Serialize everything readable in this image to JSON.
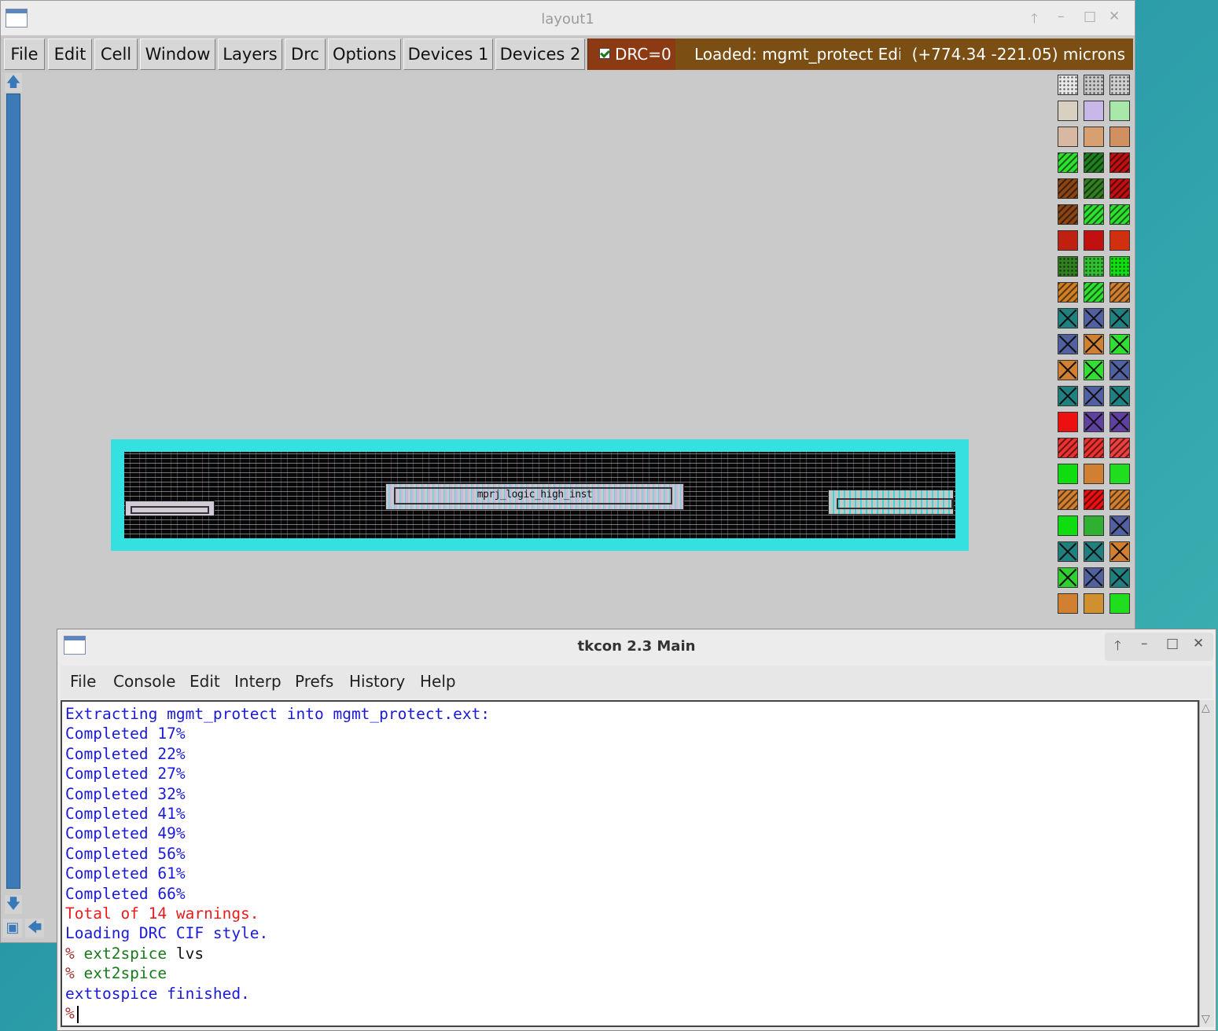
{
  "layout_window": {
    "title": "layout1",
    "controls": {
      "up": "🡑",
      "min": "–",
      "max": "□",
      "close": "✕"
    },
    "menu": [
      "File",
      "Edit",
      "Cell",
      "Window",
      "Layers",
      "Drc",
      "Options",
      "Devices 1",
      "Devices 2"
    ],
    "drc_label": "DRC=0",
    "drc_checked": true,
    "status_loaded": "Loaded: mgmt_protect Edit",
    "status_coords": "(+774.34 -221.05) microns",
    "design_label": "mprj_logic_high_inst",
    "colors": {
      "drc_bg": "#8b3a14",
      "status_bg": "#7b4e14",
      "design_outline": "#34e0e0",
      "scrollbar": "#3d7ab8"
    },
    "palette": [
      [
        "#e8e8e8",
        "#c8c8c8",
        "#d0d0d0"
      ],
      [
        "#d8d0c0",
        "#c8b8e8",
        "#a8e8a8"
      ],
      [
        "#d8b8a0",
        "#d8a070",
        "#d09060"
      ],
      [
        "#30e030",
        "#208020",
        "#c01010"
      ],
      [
        "#8b4513",
        "#308020",
        "#c01010"
      ],
      [
        "#8b4513",
        "#30e030",
        "#30e030"
      ],
      [
        "#c02010",
        "#c01010",
        "#d03010"
      ],
      [
        "#308020",
        "#30c030",
        "#10e010"
      ],
      [
        "#d08020",
        "#30e030",
        "#d08030"
      ],
      [
        "#208080",
        "#5060a0",
        "#208080"
      ],
      [
        "#5060a0",
        "#d08030",
        "#30e030"
      ],
      [
        "#d08030",
        "#30e030",
        "#5060a0"
      ],
      [
        "#208080",
        "#5060a0",
        "#208080"
      ],
      [
        "#ee1010",
        "#6040a0",
        "#6040a0"
      ],
      [
        "#ee3030",
        "#ee3030",
        "#ee4040"
      ],
      [
        "#10dd10",
        "#d08030",
        "#20dd20"
      ],
      [
        "#d08030",
        "#ee1010",
        "#d08030"
      ],
      [
        "#10dd10",
        "#30b030",
        "#5060a0"
      ],
      [
        "#208080",
        "#208080",
        "#d08030"
      ],
      [
        "#30d030",
        "#5060a0",
        "#208080"
      ],
      [
        "#d08030",
        "#d09030",
        "#20dd20"
      ]
    ]
  },
  "tkcon": {
    "title": "tkcon 2.3 Main",
    "controls": {
      "up": "🡑",
      "min": "–",
      "max": "□",
      "close": "✕"
    },
    "menu": [
      "File",
      "Console",
      "Edit",
      "Interp",
      "Prefs",
      "History",
      "Help"
    ],
    "lines": [
      {
        "prompt": "",
        "text": "Extracting mgmt_protect into mgmt_protect.ext:",
        "arg": "",
        "color": "blue"
      },
      {
        "prompt": "",
        "text": "Completed 17%",
        "arg": "",
        "color": "blue"
      },
      {
        "prompt": "",
        "text": "Completed 22%",
        "arg": "",
        "color": "blue"
      },
      {
        "prompt": "",
        "text": "Completed 27%",
        "arg": "",
        "color": "blue"
      },
      {
        "prompt": "",
        "text": "Completed 32%",
        "arg": "",
        "color": "blue"
      },
      {
        "prompt": "",
        "text": "Completed 41%",
        "arg": "",
        "color": "blue"
      },
      {
        "prompt": "",
        "text": "Completed 49%",
        "arg": "",
        "color": "blue"
      },
      {
        "prompt": "",
        "text": "Completed 56%",
        "arg": "",
        "color": "blue"
      },
      {
        "prompt": "",
        "text": "Completed 61%",
        "arg": "",
        "color": "blue"
      },
      {
        "prompt": "",
        "text": "Completed 66%",
        "arg": "",
        "color": "blue"
      },
      {
        "prompt": "",
        "text": "Total of 14 warnings.",
        "arg": "",
        "color": "red"
      },
      {
        "prompt": "",
        "text": "Loading DRC CIF style.",
        "arg": "",
        "color": "blue"
      },
      {
        "prompt": "%",
        "text": "ext2spice",
        "arg": "lvs",
        "color": "green"
      },
      {
        "prompt": "%",
        "text": "ext2spice",
        "arg": "",
        "color": "green"
      },
      {
        "prompt": "",
        "text": "exttospice finished.",
        "arg": "",
        "color": "blue"
      }
    ],
    "input_prompt": "%"
  }
}
